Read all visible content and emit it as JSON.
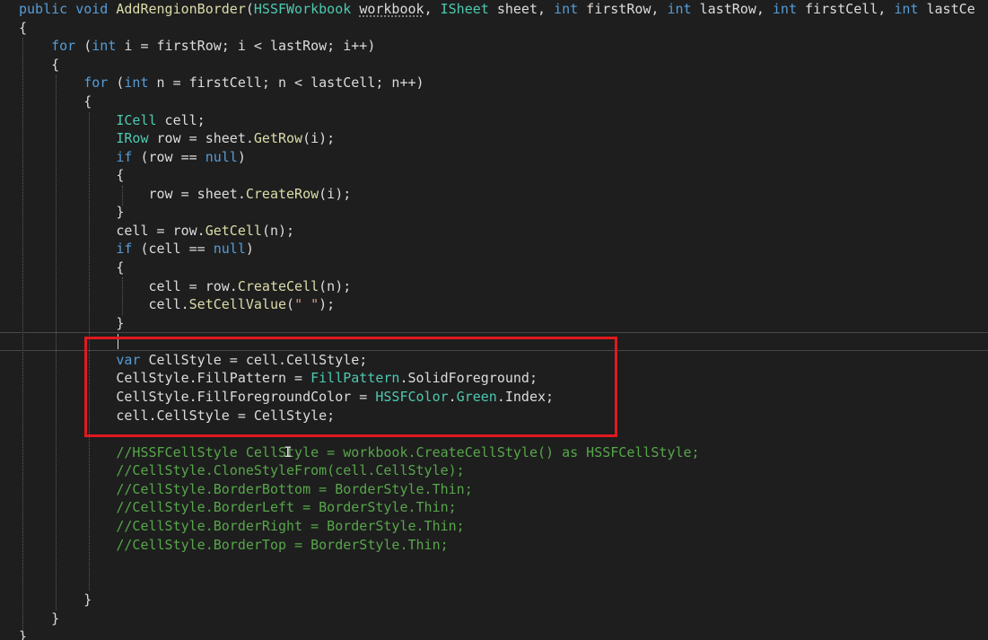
{
  "code": {
    "l01": {
      "a": "public",
      "b": "void",
      "c": "AddRengionBorder",
      "d": "(",
      "e": "HSSFWorkbook",
      "f": "workbook",
      "g": ", ",
      "h": "ISheet",
      "i": " sheet, ",
      "j": "int",
      "k": " firstRow, ",
      "m": "int",
      "n": " lastRow, ",
      "o": "int",
      "p": " firstCell, ",
      "q": "int",
      "r": " lastCe"
    },
    "l02": "{",
    "l03": {
      "a": "for",
      "b": " (",
      "c": "int",
      "d": " i = firstRow; i < lastRow; i++)"
    },
    "l04": "{",
    "l05": {
      "a": "for",
      "b": " (",
      "c": "int",
      "d": " n = firstCell; n < lastCell; n++)"
    },
    "l06": "{",
    "l07": {
      "a": "ICell",
      "b": " cell;"
    },
    "l08": {
      "a": "IRow",
      "b": " row = sheet.",
      "c": "GetRow",
      "d": "(i);"
    },
    "l09": {
      "a": "if",
      "b": " (row == ",
      "c": "null",
      "d": ")"
    },
    "l10": "{",
    "l11": {
      "a": "row = sheet.",
      "b": "CreateRow",
      "c": "(i);"
    },
    "l12": "}",
    "l13": {
      "a": "cell = row.",
      "b": "GetCell",
      "c": "(n);"
    },
    "l14": {
      "a": "if",
      "b": " (cell == ",
      "c": "null",
      "d": ")"
    },
    "l15": "{",
    "l16": {
      "a": "cell = row.",
      "b": "CreateCell",
      "c": "(n);"
    },
    "l17": {
      "a": "cell.",
      "b": "SetCellValue",
      "c": "(",
      "d": "\" \"",
      "e": ");"
    },
    "l18": "}",
    "l20": {
      "a": "var",
      "b": " CellStyle = cell.CellStyle;"
    },
    "l21": {
      "a": "CellStyle.FillPattern = ",
      "b": "FillPattern",
      "c": ".SolidForeground;"
    },
    "l22": {
      "a": "CellStyle.FillForegroundColor = ",
      "b": "HSSFColor",
      "c": ".",
      "d": "Green",
      "e": ".Index;"
    },
    "l23": "cell.CellStyle = CellStyle;",
    "l25": "//HSSFCellStyle CellStyle = workbook.CreateCellStyle() as HSSFCellStyle;",
    "l26": "//CellStyle.CloneStyleFrom(cell.CellStyle);",
    "l27": "//CellStyle.BorderBottom = BorderStyle.Thin;",
    "l28": "//CellStyle.BorderLeft = BorderStyle.Thin;",
    "l29": "//CellStyle.BorderRight = BorderStyle.Thin;",
    "l30": "//CellStyle.BorderTop = BorderStyle.Thin;",
    "l34": "}",
    "l35": "}",
    "l36": "}"
  },
  "colors": {
    "background": "#1e1e1e",
    "keyword": "#569cd6",
    "type": "#4ec9b0",
    "method": "#dcdcaa",
    "string": "#d69d85",
    "comment": "#57a64a",
    "text": "#dcdcdc",
    "highlight_box": "#e0191f"
  },
  "icons": {
    "cursor": "i-beam-cursor-icon"
  }
}
